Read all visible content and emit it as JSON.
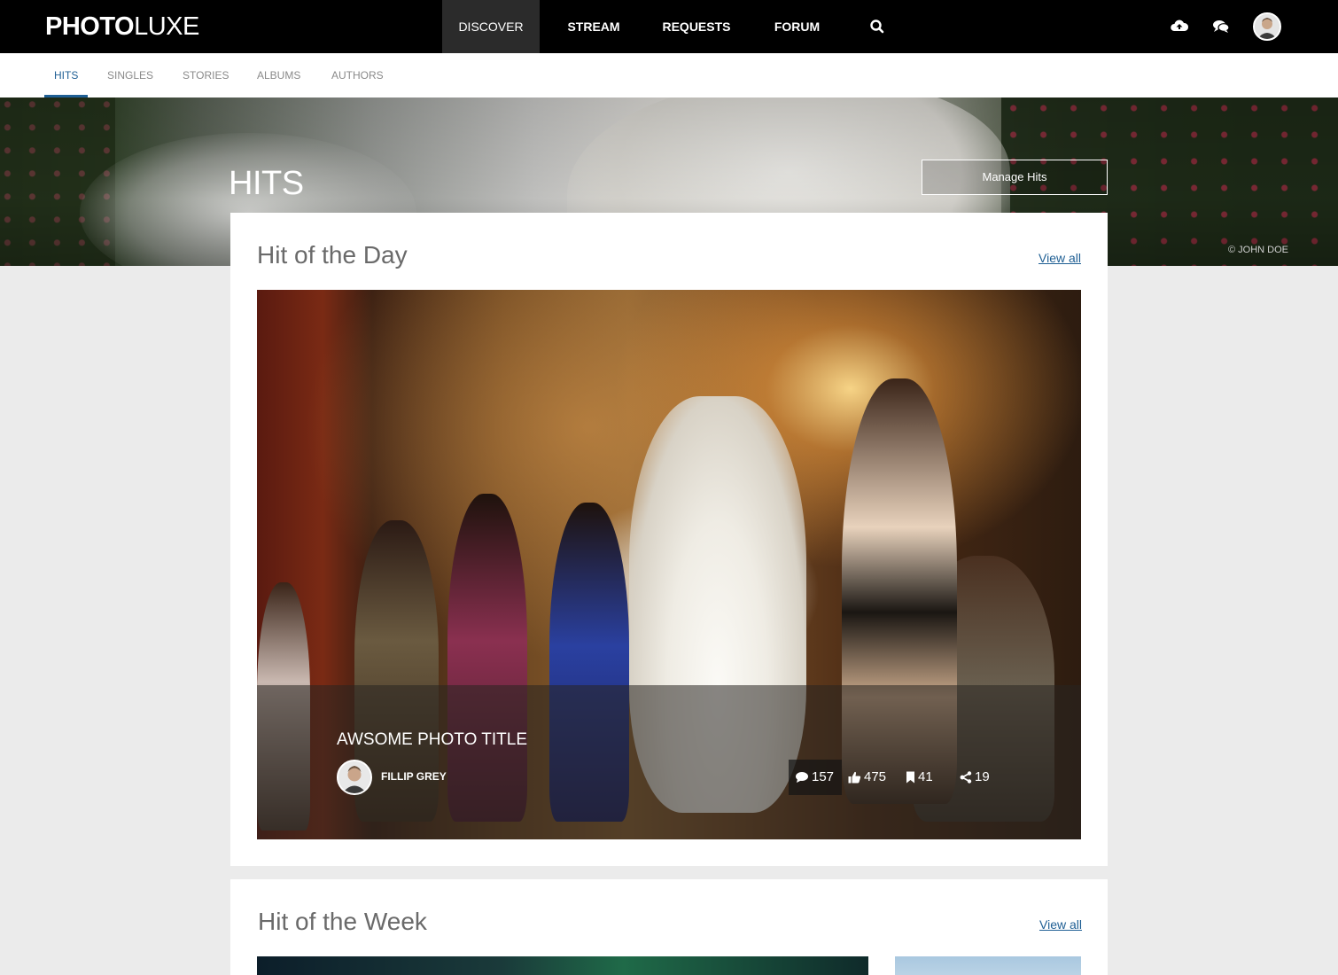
{
  "brand": {
    "bold": "PHOTO",
    "light": "LUXE"
  },
  "nav": {
    "items": [
      {
        "label": "DISCOVER",
        "active": true
      },
      {
        "label": "STREAM",
        "active": false
      },
      {
        "label": "REQUESTS",
        "active": false
      },
      {
        "label": "FORUM",
        "active": false
      }
    ],
    "icons": [
      "search-icon",
      "cloud-upload-icon",
      "chat-icon",
      "avatar"
    ]
  },
  "subnav": {
    "tabs": [
      {
        "label": "HITS",
        "active": true
      },
      {
        "label": "SINGLES",
        "active": false
      },
      {
        "label": "STORIES",
        "active": false
      },
      {
        "label": "ALBUMS",
        "active": false
      },
      {
        "label": "AUTHORS",
        "active": false
      }
    ]
  },
  "hero": {
    "title": "HITS",
    "manage_label": "Manage Hits",
    "credit": "© JOHN DOE"
  },
  "hit_of_day": {
    "title": "Hit of the Day",
    "view_all": "View all",
    "photo_title": "AWSOME PHOTO TITLE",
    "author": "FILLIP GREY",
    "stats": {
      "comments": "157",
      "likes": "475",
      "saves": "41",
      "shares": "19"
    }
  },
  "hit_of_week": {
    "title": "Hit of the Week",
    "view_all": "View all"
  },
  "colors": {
    "accent": "#1f5f94",
    "topbar": "#000000",
    "page_bg": "#ebebeb"
  }
}
